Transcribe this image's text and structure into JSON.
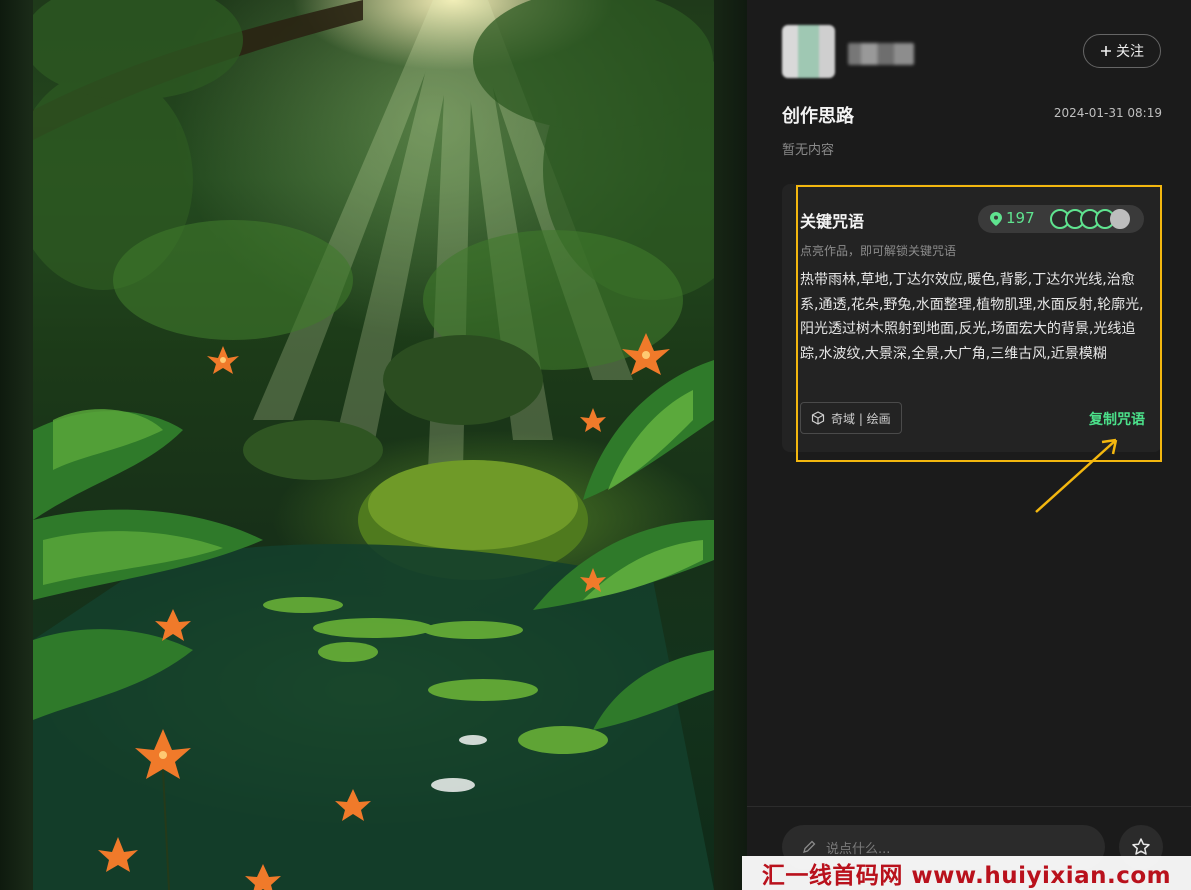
{
  "artwork": {
    "alt_subject": "tropical rainforest scene"
  },
  "author": {
    "follow_label": "关注",
    "follow_icon": "plus-icon"
  },
  "section": {
    "title": "创作思路",
    "date": "2024-01-31 08:19",
    "empty_note": "暂无内容"
  },
  "prompt_card": {
    "title": "关键咒语",
    "count": "197",
    "unlock_note": "点亮作品，即可解锁关键咒语",
    "text": "热带雨林,草地,丁达尔效应,暖色,背影,丁达尔光线,治愈系,通透,花朵,野兔,水面整理,植物肌理,水面反射,轮廓光,阳光透过树木照射到地面,反光,场面宏大的背景,光线追踪,水波纹,大景深,全景,大广角,三维古风,近景模糊",
    "tag": "奇域 | 绘画",
    "copy_label": "复制咒语"
  },
  "comment": {
    "placeholder": "说点什么..."
  },
  "watermark": "汇一线首码网 www.huiyixian.com",
  "colors": {
    "accent_green": "#4be08a",
    "highlight": "#f3b70f"
  }
}
